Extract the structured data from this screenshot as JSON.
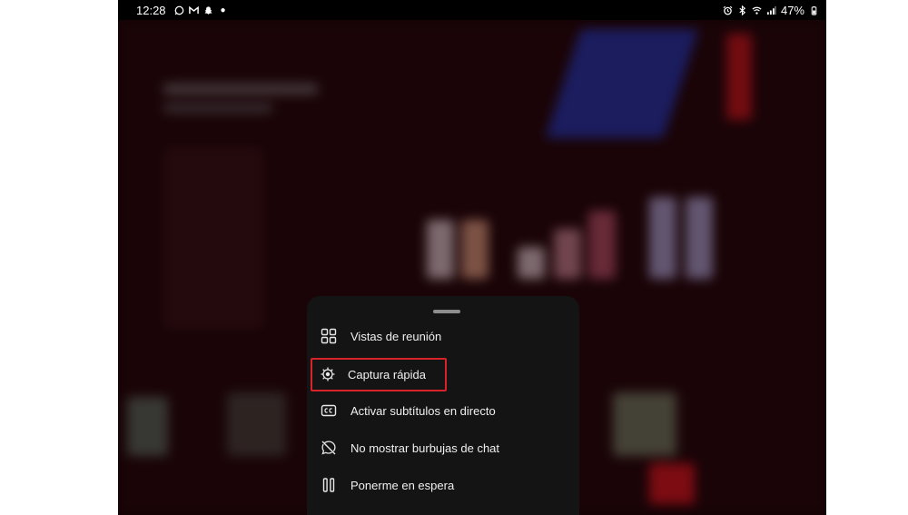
{
  "status_bar": {
    "time": "12:28",
    "battery": "47%",
    "left_icons": [
      "whatsapp-icon",
      "gmail-icon",
      "snapchat-icon"
    ],
    "right_icons": [
      "alarm-icon",
      "bluetooth-icon",
      "wifi-icon",
      "signal-icon",
      "battery-icon"
    ]
  },
  "menu": {
    "items": [
      {
        "label": "Vistas de reunión",
        "icon": "grid-icon",
        "highlighted": false
      },
      {
        "label": "Captura rápida",
        "icon": "quick-capture-icon",
        "highlighted": true
      },
      {
        "label": "Activar subtítulos en directo",
        "icon": "captions-icon",
        "highlighted": false
      },
      {
        "label": "No mostrar burbujas de chat",
        "icon": "chat-off-icon",
        "highlighted": false
      },
      {
        "label": "Ponerme en espera",
        "icon": "pause-icon",
        "highlighted": false
      }
    ]
  },
  "colors": {
    "highlight": "#d8232a",
    "sheet_bg": "#141414",
    "background": "#1c0508"
  }
}
